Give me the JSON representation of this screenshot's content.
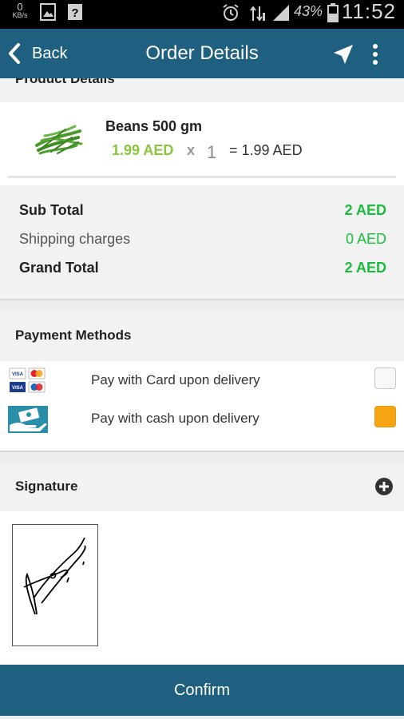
{
  "status_bar": {
    "net_speed": "0",
    "net_unit": "KB/s",
    "battery_percent": "43%",
    "time": "11:52"
  },
  "app_bar": {
    "back_label": "Back",
    "title": "Order Details",
    "icons": [
      "back-chevron-icon",
      "navigation-arrow-icon",
      "more-vert-icon"
    ]
  },
  "product_section": {
    "header": "Product Details",
    "item": {
      "name": "Beans 500 gm",
      "unit_price": "1.99 AED",
      "times": "x",
      "quantity": "1",
      "line_total": "= 1.99 AED"
    }
  },
  "totals": {
    "sub_total_label": "Sub Total",
    "sub_total_value": "2 AED",
    "shipping_label": "Shipping charges",
    "shipping_value": "0 AED",
    "grand_total_label": "Grand Total",
    "grand_total_value": "2 AED"
  },
  "payment": {
    "header": "Payment Methods",
    "methods": [
      {
        "label": "Pay with Card upon delivery",
        "selected": false,
        "icon": "credit-cards-icon"
      },
      {
        "label": "Pay with cash upon delivery",
        "selected": true,
        "icon": "cash-hand-icon"
      }
    ]
  },
  "signature": {
    "header": "Signature",
    "add_icon": "plus-circle-icon"
  },
  "confirm_label": "Confirm",
  "colors": {
    "primary": "#1f5f80",
    "price_green": "#8bc53f",
    "total_green": "#1bbc3e",
    "selected_orange": "#f7a613"
  }
}
